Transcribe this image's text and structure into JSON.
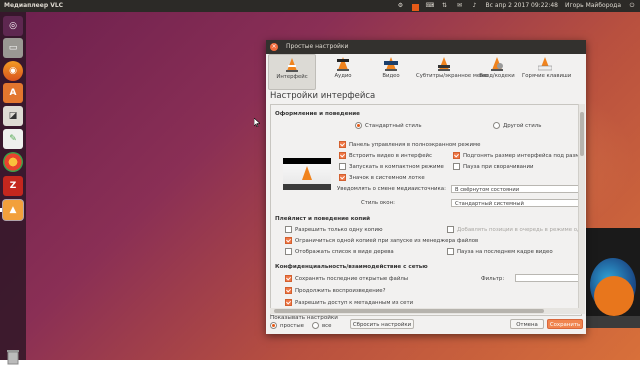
{
  "panel": {
    "app_title": "Медиаплеер VLC",
    "datetime": "Вс апр  2 2017 09:22:48",
    "user": "Игорь Майборода"
  },
  "launcher": {
    "items": [
      "ubuntu-dash",
      "files",
      "firefox",
      "software-center",
      "system-monitor",
      "chromium",
      "filezilla",
      "vlc"
    ]
  },
  "dialog": {
    "title": "Простые настройки",
    "tabs": [
      {
        "label": "Интерфейс",
        "selected": true
      },
      {
        "label": "Аудио"
      },
      {
        "label": "Видео"
      },
      {
        "label": "Субтитры/экранное меню"
      },
      {
        "label": "Ввод/кодеки"
      },
      {
        "label": "Горячие клавиши"
      }
    ],
    "header": "Настройки интерфейса",
    "look": {
      "section": "Оформление и поведение",
      "radio_standard": "Стандартный стиль",
      "radio_other": "Другой стиль",
      "cb_panel": "Панель управления в полноэкранном режиме",
      "cb_embed": "Встроить видео в интерфейс",
      "cb_resize": "Подгонять размер интерфейса под разм",
      "cb_compact": "Запускать в компактном режиме",
      "cb_pause": "Пауза при сворачивании",
      "cb_tray": "Значок в системном лотке",
      "notify_label": "Уведомлять о смене медиаисточника:",
      "notify_value": "В свёрнутом состоянии",
      "style_label": "Стиль окон:",
      "style_value": "Стандартный системный"
    },
    "playlist": {
      "section": "Плейлист и поведение копий",
      "cb_one": "Разрешить только одну копию",
      "cb_enqueue": "Добавлять позиции в очередь в режиме од",
      "cb_limit": "Ограничиться одной копией при запуске из менеджера файлов",
      "cb_tree": "Отображать список в виде дерева",
      "cb_lastframe": "Пауза на последнем кадре видео"
    },
    "privacy": {
      "section": "Конфиденциальность/взаимодействие с сетью",
      "cb_save": "Сохранять последние открытые файлы",
      "filter_label": "Фильтр:",
      "filter_value": "",
      "cb_continue": "Продолжить воспроизведение?",
      "cb_cut": "Разрешить доступ к метаданным из сети"
    },
    "show_settings": {
      "label": "Показывать настройки",
      "simple": "простые",
      "all": "все"
    },
    "buttons": {
      "reset": "Сбросить настройки",
      "cancel": "Отмена",
      "save": "Сохранить"
    }
  }
}
